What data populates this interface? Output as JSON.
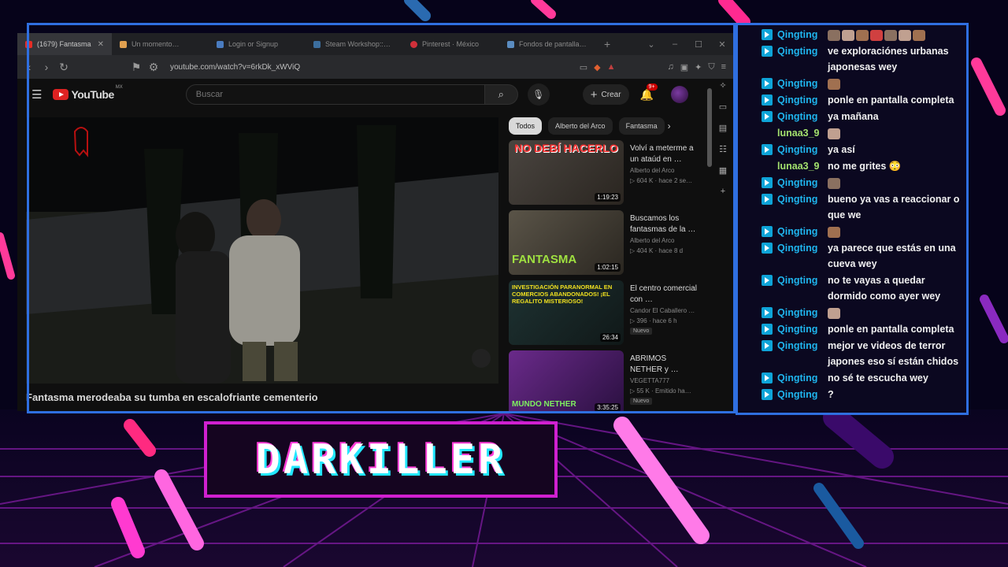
{
  "browser": {
    "tabs": [
      {
        "label": "(1679) Fantasma",
        "favicon_color": "#e52d27",
        "active": true
      },
      {
        "label": "Un momento…",
        "favicon_color": "#e0a050"
      },
      {
        "label": "Login or Signup",
        "favicon_color": "#4a7cc0"
      },
      {
        "label": "Steam Workshop::Real",
        "favicon_color": "#3c6e9e"
      },
      {
        "label": "Pinterest · México",
        "favicon_color": "#d0303a"
      },
      {
        "label": "Fondos de pantalla Jar",
        "favicon_color": "#5a8cc0"
      }
    ],
    "url": "youtube.com/watch?v=6rkDk_xWViQ"
  },
  "youtube": {
    "logo_text": "YouTube",
    "region": "MX",
    "search_placeholder": "Buscar",
    "create_label": "Crear",
    "notification_count": "9+",
    "video_title": "Fantasma merodeaba su tumba en escalofriante cementerio",
    "chips": [
      "Todos",
      "Alberto del Arco",
      "Fantasma"
    ],
    "recommendations": [
      {
        "thumb_title": "NO DEBÍ HACERLO",
        "title": "Volví a meterme a un ataúd en …",
        "channel": "Alberto del Arco",
        "stats": "▷ 604 K · hace 2 se…",
        "duration": "1:19:23",
        "badge": "",
        "thumb_bg": "#3a3530",
        "thumb_text_color": "#ff3030"
      },
      {
        "thumb_title": "FANTASMA",
        "title": "Buscamos los fantasmas de la …",
        "channel": "Alberto del Arco",
        "stats": "▷ 404 K · hace 8 d",
        "duration": "1:02:15",
        "badge": "",
        "thumb_bg": "#4a4438",
        "thumb_text_color": "#9fe040"
      },
      {
        "thumb_title": "INVESTIGACIÓN PARANORMAL EN COMERCIOS ABANDONADOS! ¡EL REGALITO MISTERIOSO!",
        "title": "El centro comercial con …",
        "channel": "Candor El Caballero …",
        "stats": "▷ 396 · hace 6 h",
        "duration": "26:34",
        "badge": "Nuevo",
        "thumb_bg": "#1c2a2a",
        "thumb_text_color": "#f0e020"
      },
      {
        "thumb_title": "MUNDO NETHER",
        "title": "ABRIMOS NETHER y …",
        "channel": "VEGETTA777",
        "stats": "▷ 55 K · Emitido ha…",
        "duration": "3:35:25",
        "badge": "Nuevo",
        "thumb_bg": "#5a2a7a",
        "thumb_text_color": "#7ef060"
      }
    ]
  },
  "chat": {
    "messages": [
      {
        "user": "Qingting",
        "text": "",
        "emotes": 7,
        "user_color": "#1fb5ee"
      },
      {
        "user": "Qingting",
        "text": "ve exploraciónes urbanas japonesas wey",
        "user_color": "#1fb5ee"
      },
      {
        "user": "Qingting",
        "text": "",
        "emotes": 1,
        "user_color": "#1fb5ee"
      },
      {
        "user": "Qingting",
        "text": "ponle en pantalla completa",
        "user_color": "#1fb5ee"
      },
      {
        "user": "Qingting",
        "text": "ya mañana",
        "user_color": "#1fb5ee"
      },
      {
        "user": "lunaa3_9",
        "text": "",
        "emotes": 1,
        "user_color": "#a3e06e"
      },
      {
        "user": "Qingting",
        "text": "ya así",
        "user_color": "#1fb5ee"
      },
      {
        "user": "lunaa3_9",
        "text": "no me grites 😳",
        "user_color": "#a3e06e"
      },
      {
        "user": "Qingting",
        "text": "",
        "emotes": 1,
        "user_color": "#1fb5ee"
      },
      {
        "user": "Qingting",
        "text": "bueno ya vas a reaccionar o que we",
        "user_color": "#1fb5ee"
      },
      {
        "user": "Qingting",
        "text": "",
        "emotes": 1,
        "user_color": "#1fb5ee"
      },
      {
        "user": "Qingting",
        "text": "ya parece que estás en una cueva wey",
        "user_color": "#1fb5ee"
      },
      {
        "user": "Qingting",
        "text": "no te vayas a quedar dormido como ayer wey",
        "user_color": "#1fb5ee"
      },
      {
        "user": "Qingting",
        "text": "",
        "emotes": 1,
        "user_color": "#1fb5ee"
      },
      {
        "user": "Qingting",
        "text": "ponle en pantalla completa",
        "user_color": "#1fb5ee"
      },
      {
        "user": "Qingting",
        "text": "mejor ve videos de terror japones eso sí están chidos",
        "user_color": "#1fb5ee"
      },
      {
        "user": "Qingting",
        "text": "no sé te escucha wey",
        "user_color": "#1fb5ee"
      },
      {
        "user": "Qingting",
        "text": "?",
        "user_color": "#1fb5ee"
      }
    ]
  },
  "banner": {
    "name": "DARKILLER",
    "border_color": "#d020d0"
  }
}
